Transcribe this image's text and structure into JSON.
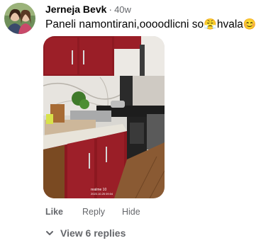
{
  "comment": {
    "author": "Jerneja Bevk",
    "separator": "·",
    "time": "40w",
    "text": "Paneli namontirani,oooodlicni so",
    "emoji_1": "😤",
    "text_2": "hvala",
    "emoji_2": "😊"
  },
  "photo": {
    "watermark_line1": "realme 10",
    "watermark_line2": "2023.10.25 09:04"
  },
  "actions": {
    "like": "Like",
    "reply": "Reply",
    "hide": "Hide"
  },
  "replies": {
    "label": "View 6 replies"
  },
  "colors": {
    "text": "#050505",
    "secondary": "#65676b",
    "cabinet_red": "#8e1a22"
  },
  "icons": {
    "chevron": "chevron-down-icon"
  }
}
